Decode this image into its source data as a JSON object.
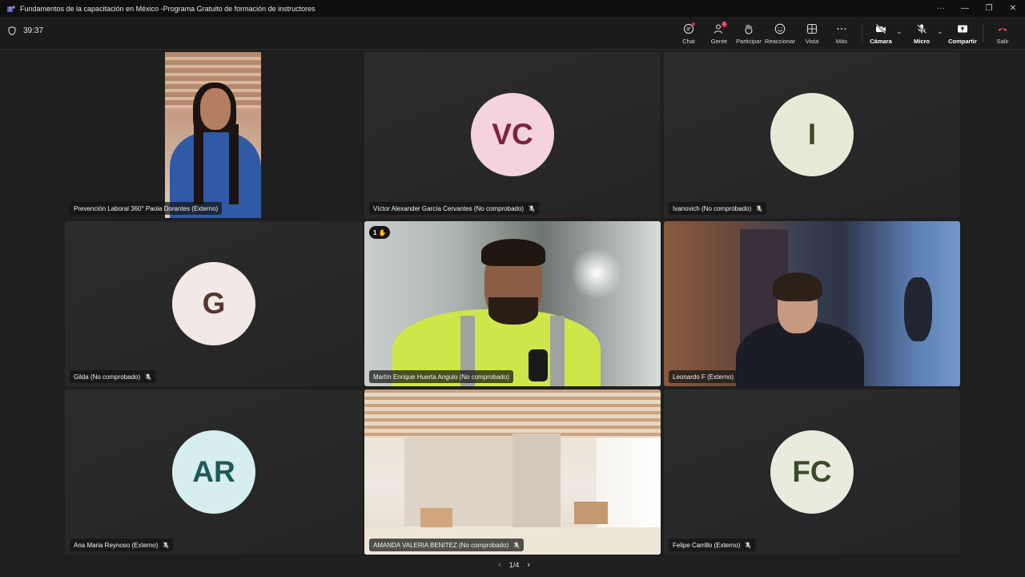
{
  "window": {
    "title": "Fundamentos de la capacitación en México -Programa Gratuito de formación de instructores",
    "controls": [
      "···",
      "—",
      "❐",
      "✕"
    ]
  },
  "meeting": {
    "timer": "39:37"
  },
  "toolbar": {
    "chat": "Chat",
    "people": "Gente",
    "people_badge": "1",
    "participate": "Participar",
    "react": "Reaccionar",
    "view": "Vista",
    "more": "Más",
    "camera": "Cámara",
    "mic": "Micro",
    "share": "Compartir",
    "leave": "Salir"
  },
  "tiles": [
    {
      "name": "Prevención Laboral 360° Paola Dorantes (Externo)",
      "type": "video"
    },
    {
      "name": "Víctor Alexander García Cervantes (No comprobado)",
      "initials": "VC",
      "avatar_color": "#f4d3de",
      "text_color": "#7d2244",
      "muted": true
    },
    {
      "name": "Ivanovich (No comprobado)",
      "initials": "I",
      "avatar_color": "#e8ead8",
      "text_color": "#3f4a24",
      "muted": true
    },
    {
      "name": "Gilda (No comprobado)",
      "initials": "G",
      "avatar_color": "#f2e8e6",
      "text_color": "#52362f",
      "muted": true
    },
    {
      "name": "Martín Enrique Huerta Angulo (No comprobado)",
      "type": "video",
      "hand_raised": "1"
    },
    {
      "name": "Leonardo F (Externo)",
      "type": "video"
    },
    {
      "name": "Ana Maria Reynoso (Externo)",
      "initials": "AR",
      "avatar_color": "#d6eeee",
      "text_color": "#1f5957",
      "muted": true
    },
    {
      "name": "AMANDA VALERIA BENITEZ (No comprobado)",
      "type": "video",
      "muted": true
    },
    {
      "name": "Felipe Carrillo (Externo)",
      "initials": "FC",
      "avatar_color": "#e9ebde",
      "text_color": "#3d4a2b",
      "muted": true
    }
  ],
  "pager": {
    "label": "1/4"
  }
}
